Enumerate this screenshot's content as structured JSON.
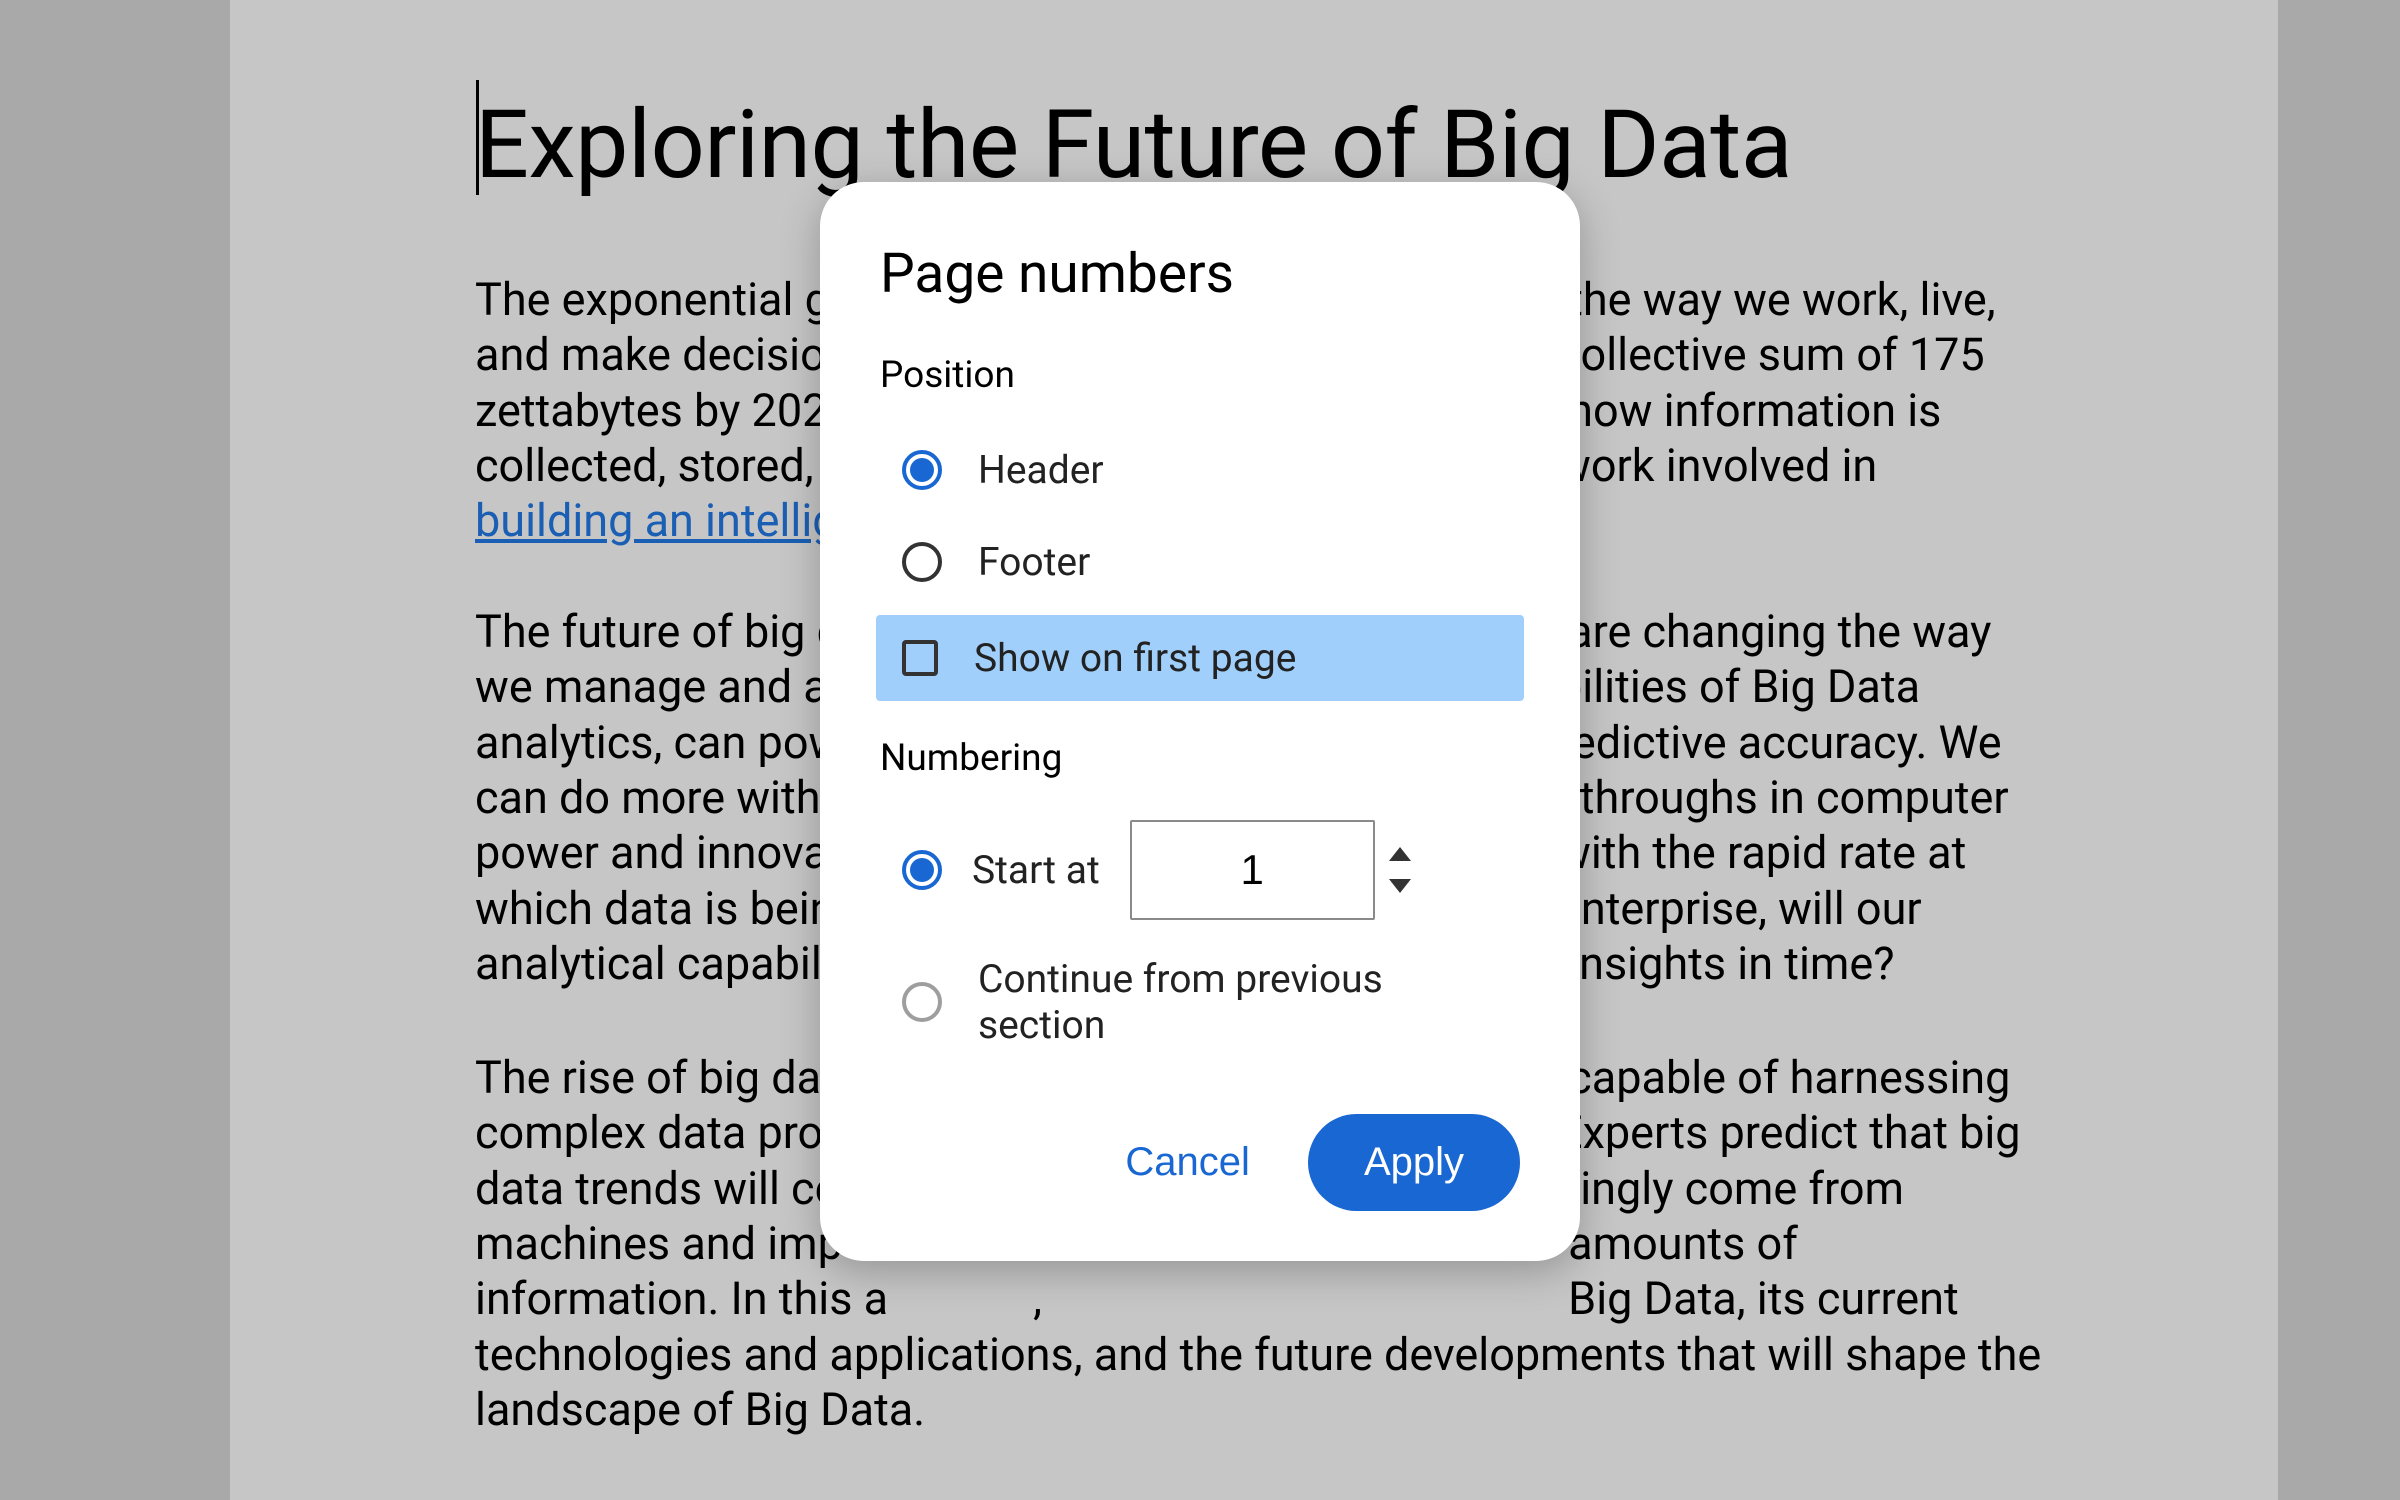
{
  "document": {
    "title": "Exploring the Future of Big Data",
    "p1_left": "The exponential gr\nand make decision\nzettabytes by 202\ncollected, stored, a",
    "p1_link": "building an intellig",
    "p1_right": " the way we work, live,\ncollective sum of 175\n how information is\nwork involved in",
    "p2_left": "The future of big d\nwe manage and ar\nanalytics, can pow\ncan do more with l\npower and innovat\nwhich data is bein\nanalytical capabilit",
    "p2_right": " are changing the way\nbilities of Big Data\nredictive accuracy. We\nkthroughs in computer\nwith the rapid rate at\nenterprise, will our\n insights in time?",
    "p3_left": "The rise of big dat\ncomplex data proc\ndata trends will co\nmachines and imp\ninformation. In this a             ,\ntechnologies and applications, and the future developments that will shape the\nlandscape of Big Data.",
    "p3_right": " capable of harnessing\nExperts predict that big\nsingly come from\n amounts of\n Big Data, its current"
  },
  "dialog": {
    "title": "Page numbers",
    "position_label": "Position",
    "option_header": "Header",
    "option_footer": "Footer",
    "option_first_page": "Show on first page",
    "numbering_label": "Numbering",
    "start_at_label": "Start at",
    "start_at_value": "1",
    "continue_label": "Continue from previous section",
    "cancel": "Cancel",
    "apply": "Apply"
  }
}
